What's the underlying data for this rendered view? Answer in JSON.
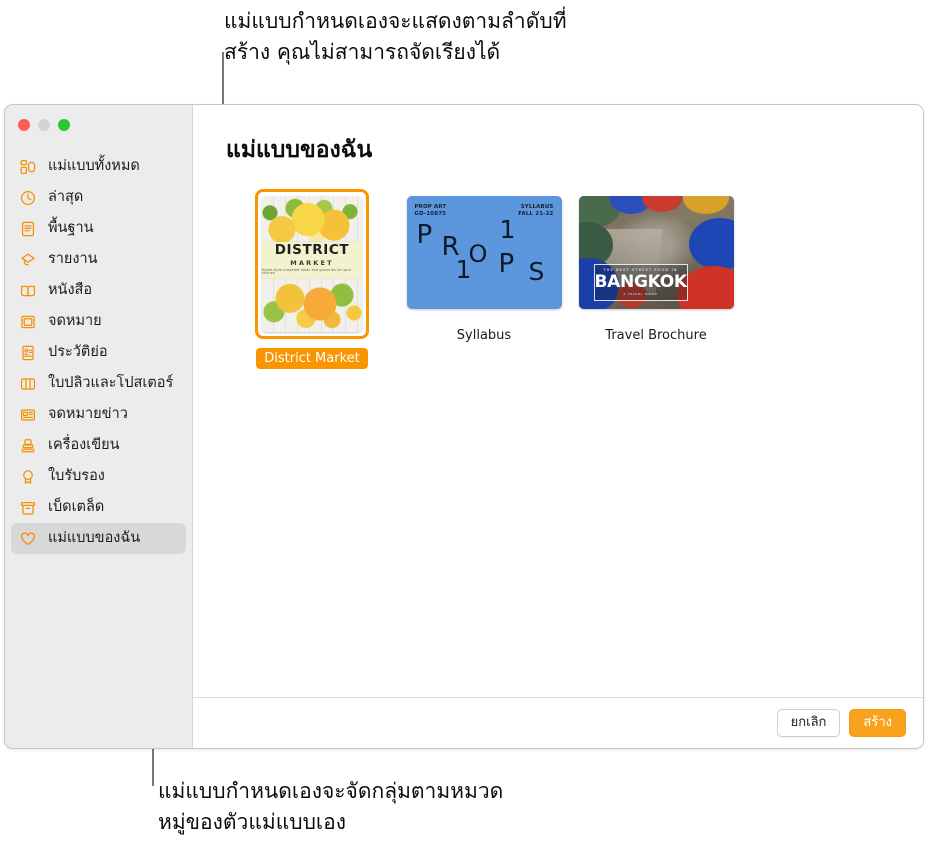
{
  "annotations": {
    "top": "แม่แบบกำหนดเองจะแสดงตามลำดับที่\nสร้าง คุณไม่สามารถจัดเรียงได้",
    "bottom": "แม่แบบกำหนดเองจะจัดกลุ่มตามหมวด\nหมู่ของตัวแม่แบบเอง"
  },
  "window": {
    "traffic_lights": {
      "close": "close-button",
      "minimize": "minimize-button",
      "maximize": "maximize-button"
    }
  },
  "sidebar": {
    "items": [
      {
        "label": "แม่แบบทั้งหมด",
        "icon": "all-templates-icon",
        "selected": false
      },
      {
        "label": "ล่าสุด",
        "icon": "clock-icon",
        "selected": false
      },
      {
        "label": "พื้นฐาน",
        "icon": "document-icon",
        "selected": false
      },
      {
        "label": "รายงาน",
        "icon": "graduation-cap-icon",
        "selected": false
      },
      {
        "label": "หนังสือ",
        "icon": "open-book-icon",
        "selected": false
      },
      {
        "label": "จดหมาย",
        "icon": "letter-frame-icon",
        "selected": false
      },
      {
        "label": "ประวัติย่อ",
        "icon": "resume-card-icon",
        "selected": false
      },
      {
        "label": "ใบปลิวและโปสเตอร์",
        "icon": "brochure-icon",
        "selected": false
      },
      {
        "label": "จดหมายข่าว",
        "icon": "newspaper-icon",
        "selected": false
      },
      {
        "label": "เครื่องเขียน",
        "icon": "stamp-icon",
        "selected": false
      },
      {
        "label": "ใบรับรอง",
        "icon": "award-ribbon-icon",
        "selected": false
      },
      {
        "label": "เบ็ดเตล็ด",
        "icon": "archive-box-icon",
        "selected": false
      },
      {
        "label": "แม่แบบของฉัน",
        "icon": "heart-icon",
        "selected": true
      }
    ]
  },
  "main": {
    "section_title": "แม่แบบของฉัน",
    "templates": [
      {
        "name": "District Market",
        "selected": true,
        "thumbnail": {
          "kind": "poster-citrus",
          "title": "DISTRICT",
          "subtitle": "MARKET",
          "tagline": "Home-style prepared foods and groceries for your kitchen"
        }
      },
      {
        "name": "Syllabus",
        "selected": false,
        "thumbnail": {
          "kind": "syllabus-blue",
          "corner_left": "PROP ART\nGD-10875",
          "corner_right": "SYLLABUS\nFALL 21-22",
          "letters": [
            "P",
            "R",
            "1",
            "O",
            "1",
            "P",
            "S"
          ],
          "background_color": "#5c97dd"
        }
      },
      {
        "name": "Travel Brochure",
        "selected": false,
        "thumbnail": {
          "kind": "travel-bangkok",
          "overlay_small": "THE BEST STREET FOOD IN",
          "overlay_big": "BANGKOK",
          "overlay_tiny": "A TRAVEL GUIDE"
        }
      }
    ]
  },
  "footer": {
    "cancel_label": "ยกเลิก",
    "create_label": "สร้าง"
  },
  "colors": {
    "accent": "#f59100",
    "create_button": "#f9a21b",
    "selection_ring": "#f99500",
    "sidebar_bg": "#ececec",
    "sidebar_selected": "#d8d8d8",
    "syllabus_blue": "#5c97dd"
  }
}
